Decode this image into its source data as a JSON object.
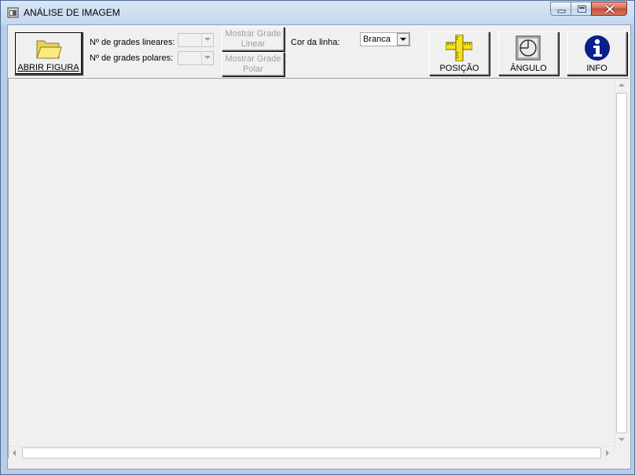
{
  "window": {
    "title": "ANÁLISE DE IMAGEM"
  },
  "toolbar": {
    "open_label": "ABRIR FIGURA",
    "linear_grids_label": "Nº de grades lineares:",
    "polar_grids_label": "Nº de grades polares:",
    "linear_grids_value": "",
    "polar_grids_value": "",
    "show_linear_line1": "Mostrar Grade",
    "show_linear_line2": "Linear",
    "show_polar_line1": "Mostrar Grade",
    "show_polar_line2": "Polar",
    "line_color_label": "Cor da linha:",
    "line_color_value": "Branca",
    "position_label": "POSIÇÃO",
    "angle_label": "ÂNGULO",
    "info_label": "INFO"
  },
  "colors": {
    "accent_info": "#0a1e8c",
    "folder_yellow": "#f2e36b",
    "ruler_yellow": "#f5e21a"
  },
  "icons": [
    "app-icon",
    "folder-icon",
    "ruler-icon",
    "angle-icon",
    "info-icon",
    "minimize-icon",
    "maximize-icon",
    "close-icon"
  ]
}
